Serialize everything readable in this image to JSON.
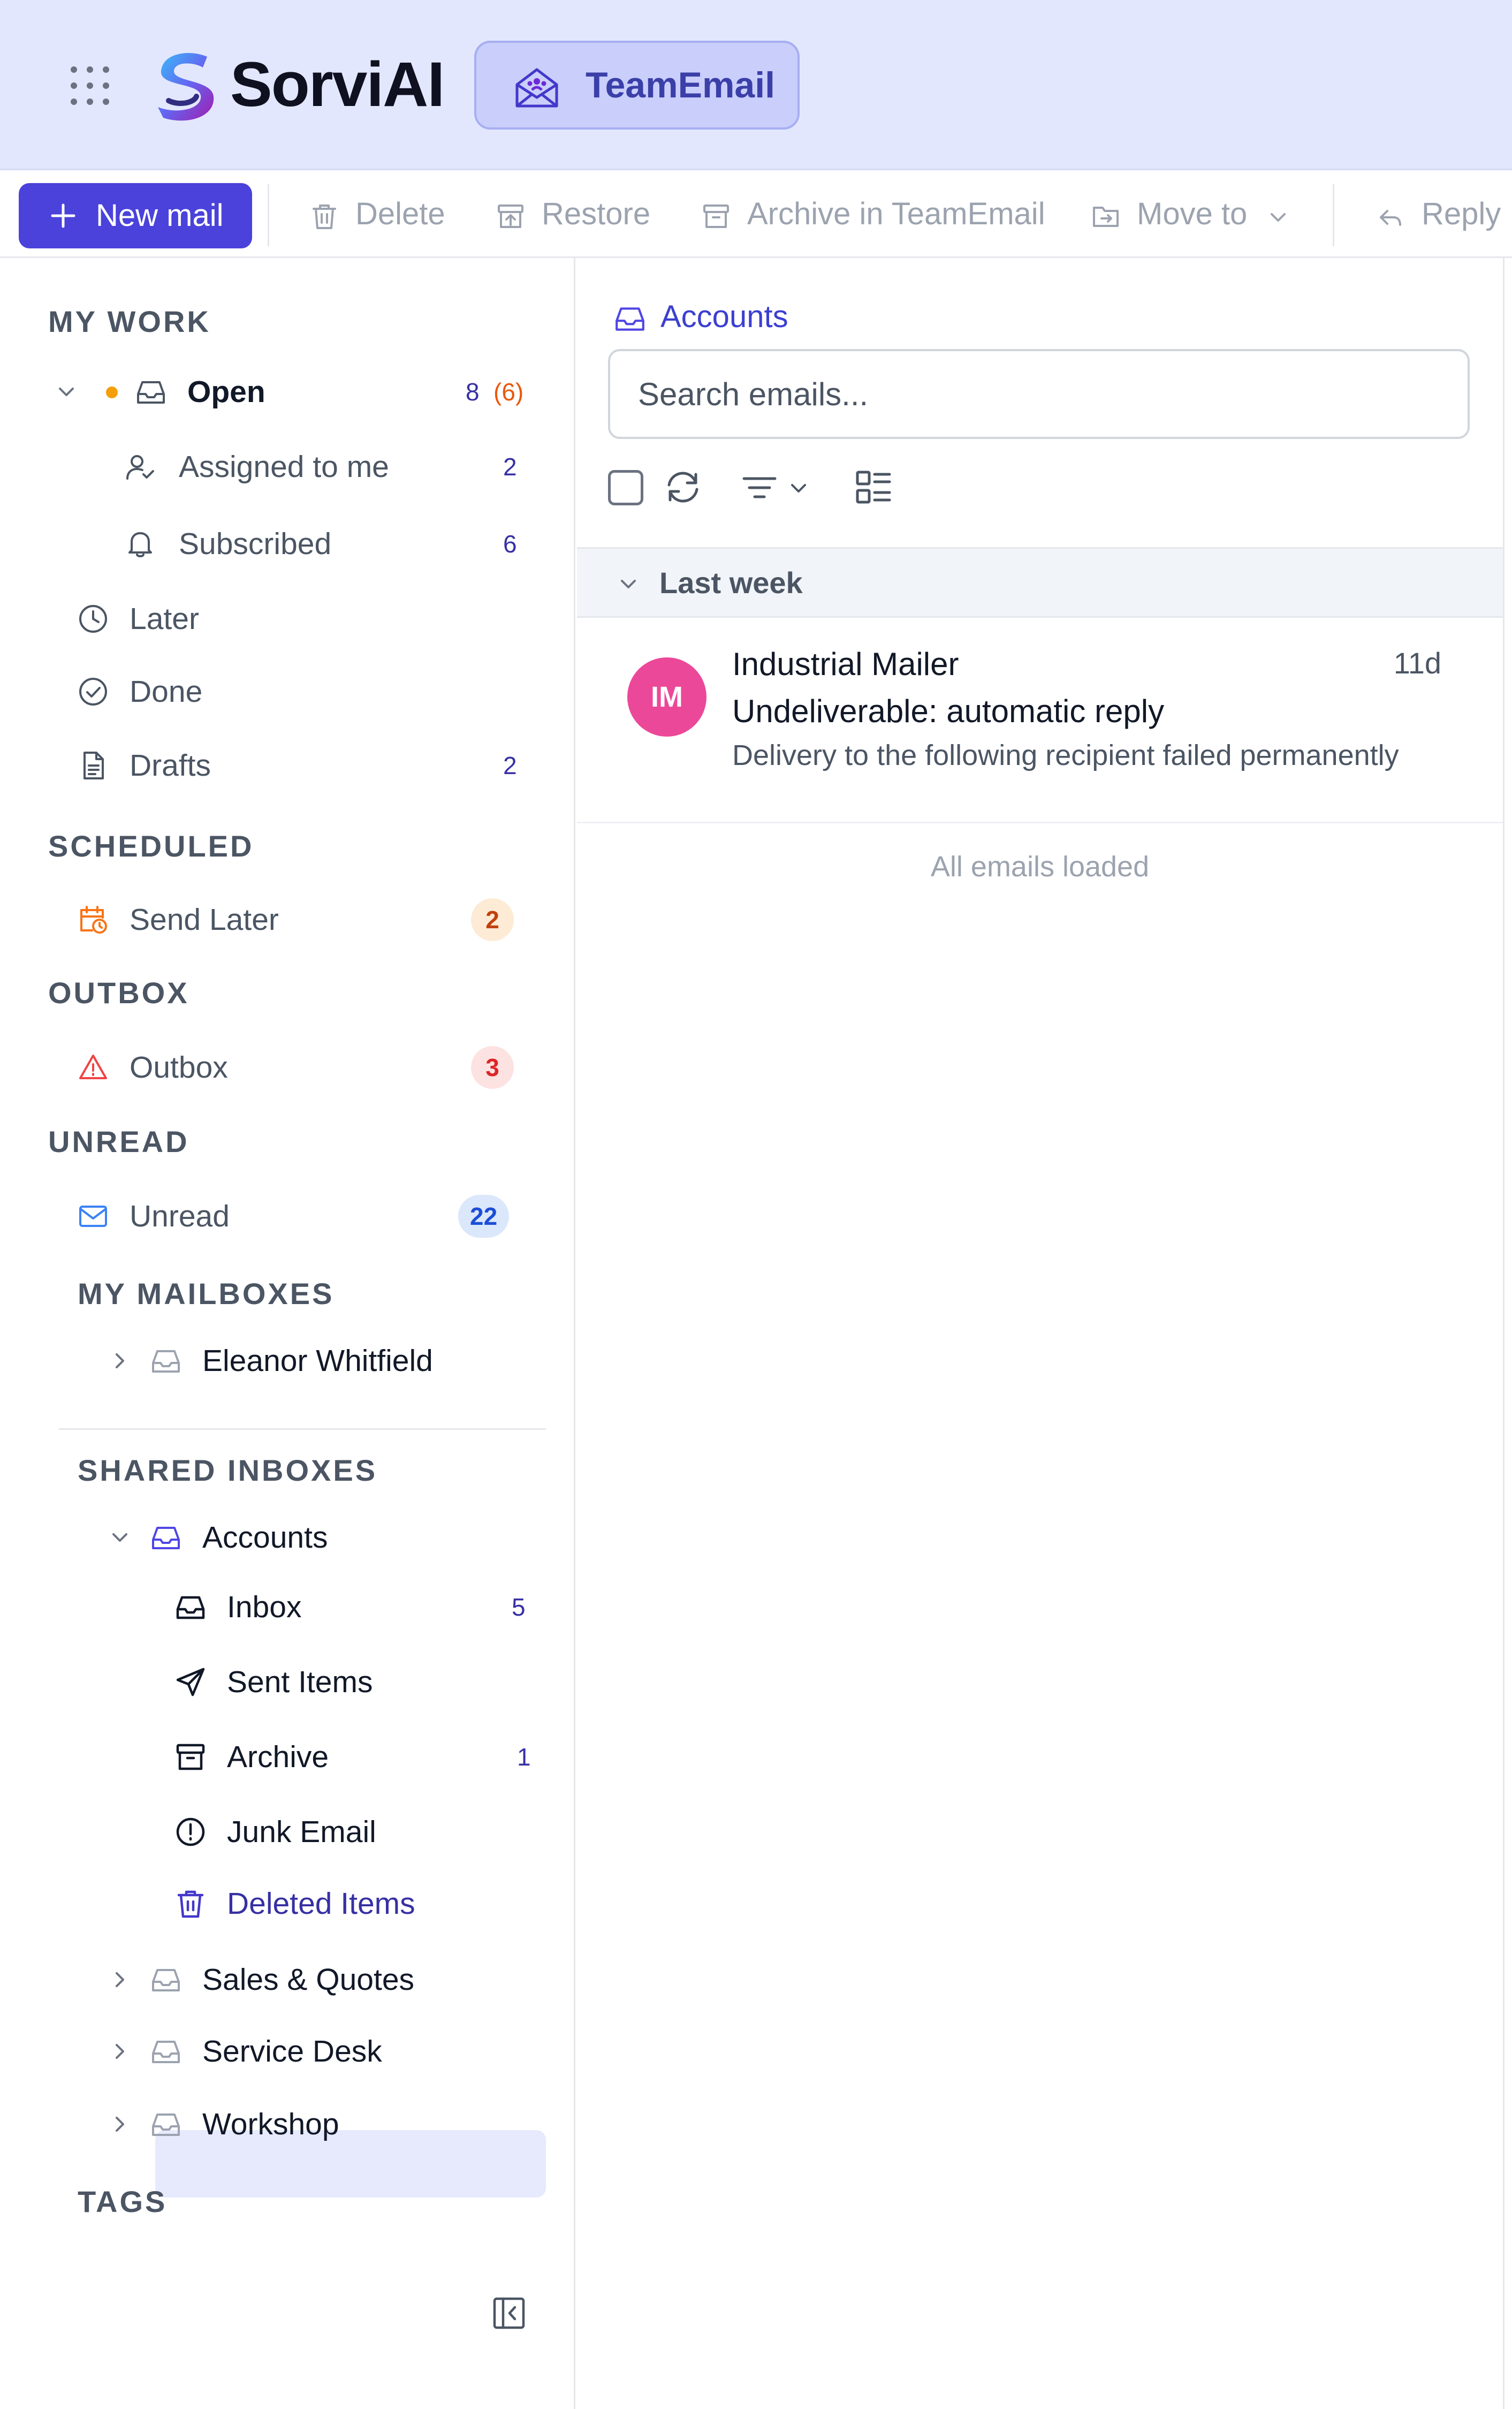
{
  "header": {
    "app_name": "SorviAI",
    "workspace_label": "TeamEmail",
    "icons": {
      "launcher": "grid-dots-icon",
      "logo": "sorviai-logo",
      "workspace": "team-envelope-icon"
    }
  },
  "toolbar": {
    "new_mail": "New mail",
    "delete": "Delete",
    "restore": "Restore",
    "archive": "Archive in TeamEmail",
    "move_to": "Move to",
    "reply": "Reply"
  },
  "sidebar": {
    "my_work_heading": "MY WORK",
    "open_label": "Open",
    "open_count": "8",
    "open_unread": "(6)",
    "assigned_label": "Assigned to me",
    "assigned_count": "2",
    "subscribed_label": "Subscribed",
    "subscribed_count": "6",
    "later_label": "Later",
    "done_label": "Done",
    "drafts_label": "Drafts",
    "drafts_count": "2",
    "scheduled_heading": "SCHEDULED",
    "send_later_label": "Send Later",
    "send_later_count": "2",
    "outbox_heading": "OUTBOX",
    "outbox_label": "Outbox",
    "outbox_count": "3",
    "unread_heading": "UNREAD",
    "unread_label": "Unread",
    "unread_count": "22",
    "my_mailboxes_heading": "MY MAILBOXES",
    "personal_mailbox": "Eleanor Whitfield",
    "shared_heading": "SHARED INBOXES",
    "accounts_label": "Accounts",
    "folders": {
      "inbox": "Inbox",
      "inbox_count": "5",
      "sent": "Sent Items",
      "archive": "Archive",
      "archive_count": "1",
      "junk": "Junk Email",
      "deleted": "Deleted Items"
    },
    "other_shared": [
      "Sales & Quotes",
      "Service Desk",
      "Workshop"
    ],
    "tags_heading": "TAGS"
  },
  "colors": {
    "accent": "#4a42db",
    "header_bg": "#e3e7fd",
    "open_dot": "#f59e0b",
    "send_later_badge": "#fdebd6",
    "outbox_badge": "#fde2e2",
    "unread_badge": "#dbe7fb",
    "avatar": "#ec4899"
  },
  "main": {
    "breadcrumb": "Accounts",
    "search_placeholder": "Search emails...",
    "group_label": "Last week",
    "emails": [
      {
        "initials": "IM",
        "sender": "Industrial Mailer",
        "time": "11d",
        "subject": "Undeliverable: automatic reply",
        "preview": "Delivery to the following recipient failed permanently"
      }
    ],
    "footer": "All emails loaded"
  }
}
